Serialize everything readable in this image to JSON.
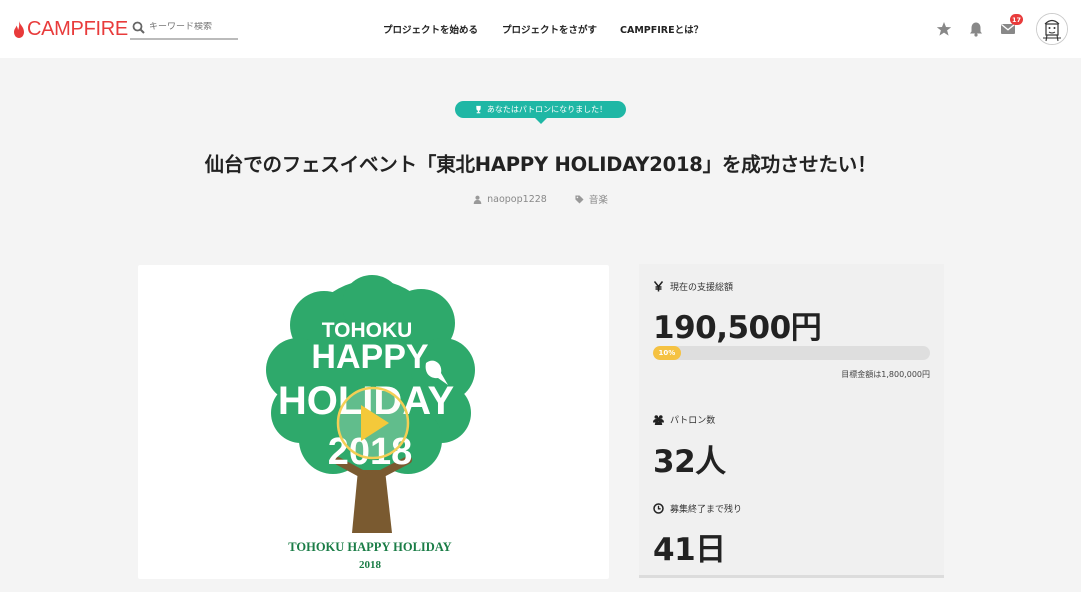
{
  "header": {
    "logo_text": "CAMPFIRE",
    "search_placeholder": "キーワード検索",
    "nav": [
      "プロジェクトを始める",
      "プロジェクトをさがす",
      "CAMPFIREとは？"
    ],
    "mail_badge": "17",
    "brand_color": "#e83b3b"
  },
  "project": {
    "patron_notice": "あなたはパトロンになりました！",
    "title": "仙台でのフェスイベント「東北HAPPY HOLIDAY2018」を成功させたい！",
    "author": "naopop1228",
    "category": "音楽",
    "accent_color": "#1fb7a5"
  },
  "video": {
    "logo_lines": [
      "TOHOKU",
      "HAPPY",
      "HOLIDAY",
      "2018"
    ],
    "caption_line1": "TOHOKU HAPPY HOLIDAY",
    "caption_line2": "2018"
  },
  "stats": {
    "total_label": "現在の支援総額",
    "total_value": "190,500円",
    "progress_percent": 10,
    "progress_label": "10%",
    "goal_text": "目標金額は1,800,000円",
    "patrons_label": "パトロン数",
    "patrons_value": "32人",
    "remaining_label": "募集終了まで残り",
    "remaining_value": "41日"
  }
}
